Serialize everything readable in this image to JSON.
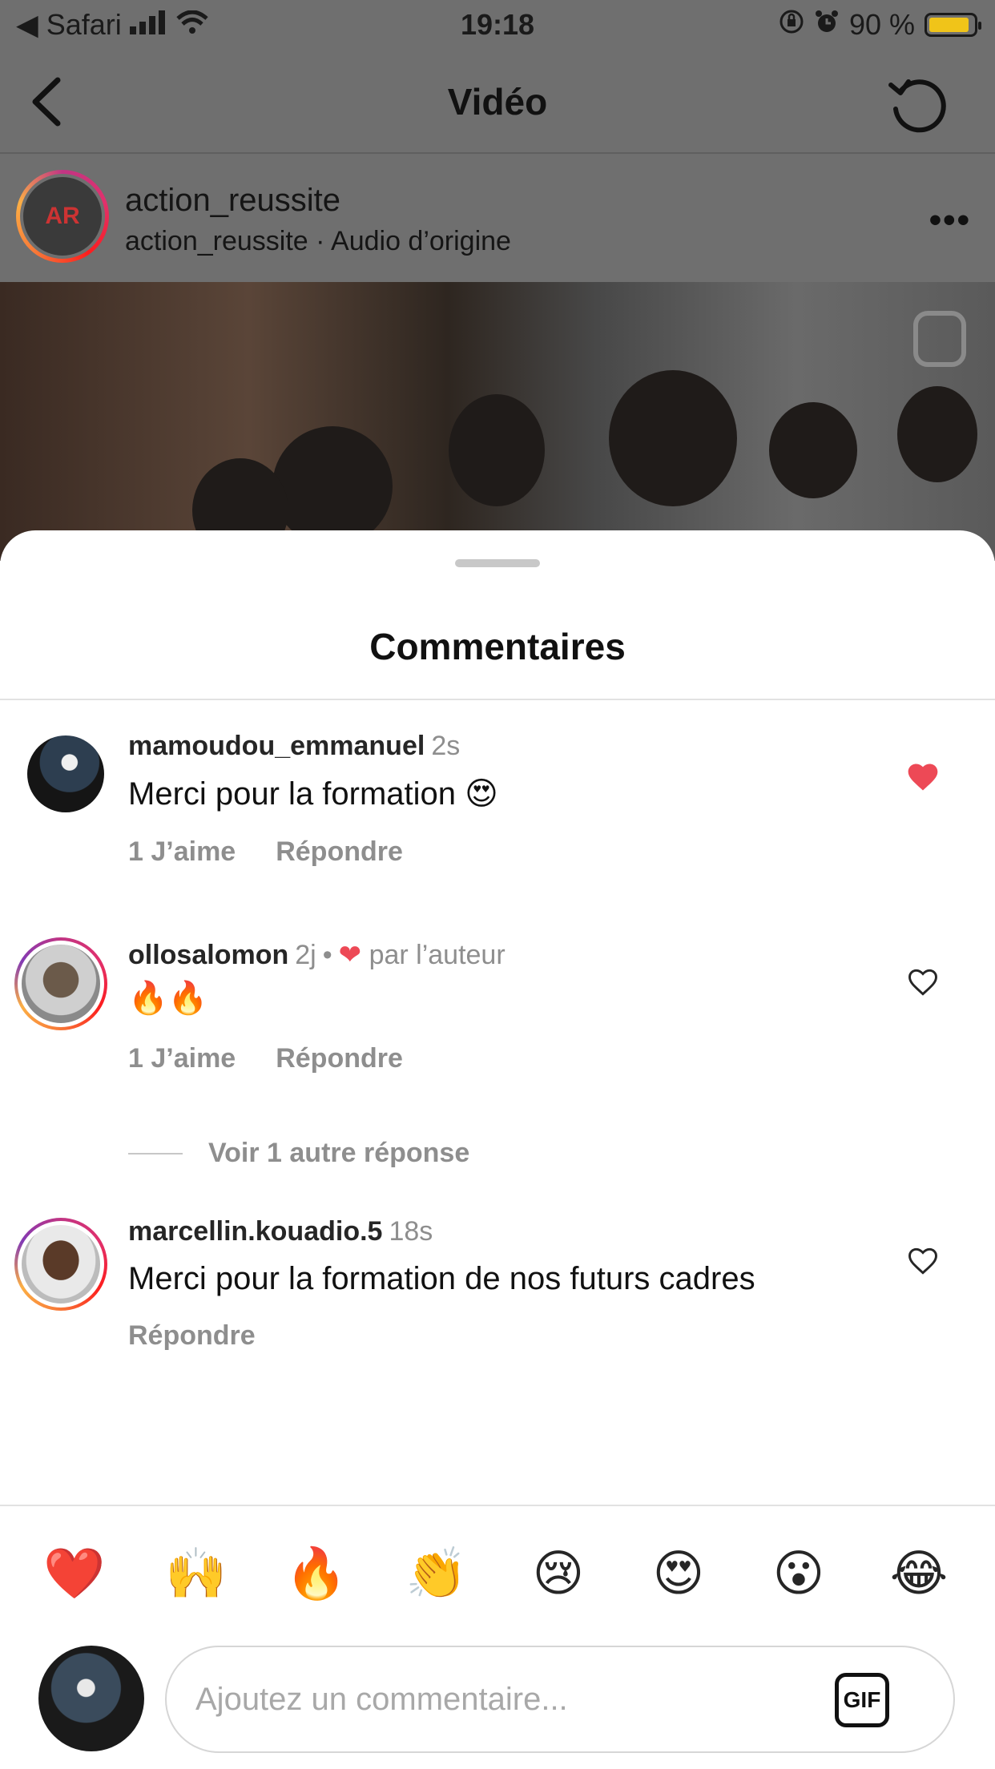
{
  "status_bar": {
    "back_app": "Safari",
    "time": "19:18",
    "battery_percent": "90 %",
    "battery_level": 0.9
  },
  "nav": {
    "title": "Vidéo"
  },
  "post": {
    "username": "action_reussite",
    "audio": "action_reussite · Audio d’origine",
    "avatar_text": "AR"
  },
  "comments_sheet": {
    "title": "Commentaires",
    "comments": [
      {
        "username": "mamoudou_emmanuel",
        "time": "2s",
        "text": "Merci pour la formation 😍",
        "likes": "1 J’aime",
        "reply": "Répondre",
        "liked": true
      },
      {
        "username": "ollosalomon",
        "time": "2j",
        "liked_by_author": "par l’auteur",
        "text": "🔥🔥",
        "likes": "1 J’aime",
        "reply": "Répondre",
        "liked": false
      },
      {
        "username": "marcellin.kouadio.5",
        "time": "18s",
        "text": "Merci pour la formation de nos futurs cadres",
        "reply": "Répondre",
        "liked": false
      }
    ],
    "view_replies": "Voir 1 autre réponse"
  },
  "emoji_bar": [
    "❤️",
    "🙌",
    "🔥",
    "👏",
    "😢",
    "😍",
    "😮",
    "😂"
  ],
  "composer": {
    "placeholder": "Ajoutez un commentaire...",
    "gif_label": "GIF"
  },
  "colors": {
    "like_red": "#ed4956",
    "secondary_text": "#8e8e8e"
  }
}
